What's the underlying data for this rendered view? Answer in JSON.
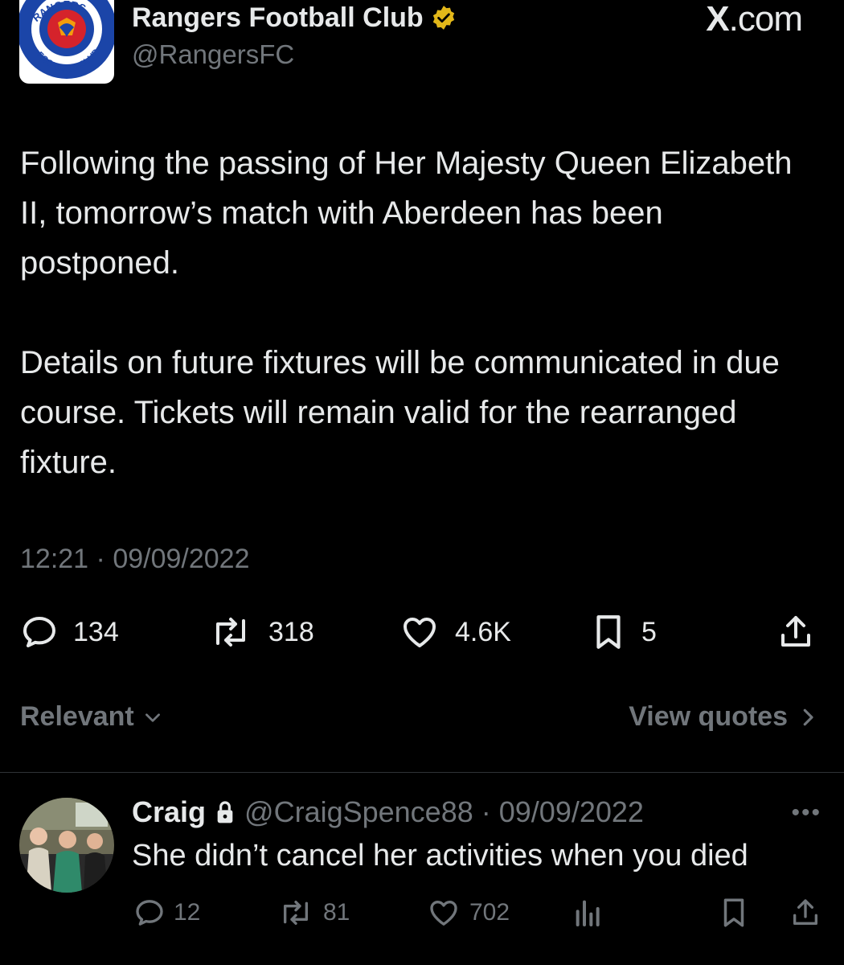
{
  "watermark": {
    "x": "X",
    "suffix": ".com"
  },
  "author": {
    "display_name": "Rangers Football Club",
    "handle": "@RangersFC",
    "verified_icon": "gold-verified-badge-icon",
    "logo": {
      "top_text": "RANGERS",
      "bottom_text": "FOOTBALL CLUB",
      "motto": "READY"
    }
  },
  "tweet": {
    "paragraphs": [
      "Following the passing of Her Majesty Queen Elizabeth II, tomorrow’s match with Aberdeen has been postponed.",
      "Details on future fixtures will be communicated in due course. Tickets will remain valid for the rearranged fixture."
    ],
    "time": "12:21",
    "separator": "·",
    "date": "09/09/2022"
  },
  "stats": {
    "replies": "134",
    "reposts": "318",
    "likes": "4.6K",
    "bookmarks": "5"
  },
  "sort": {
    "label": "Relevant"
  },
  "quotes": {
    "label": "View quotes"
  },
  "reply": {
    "name": "Craig",
    "lock_icon": "lock-icon",
    "handle": "@CraigSpence88",
    "separator": "·",
    "date": "09/09/2022",
    "text": "She didn’t cancel her activities when you died",
    "stats": {
      "replies": "12",
      "reposts": "81",
      "likes": "702"
    }
  },
  "colors": {
    "background": "#000000",
    "text": "#e7e9ea",
    "secondary": "#71767b",
    "verified_gold": "#e2b719",
    "divider": "#2f3336"
  }
}
